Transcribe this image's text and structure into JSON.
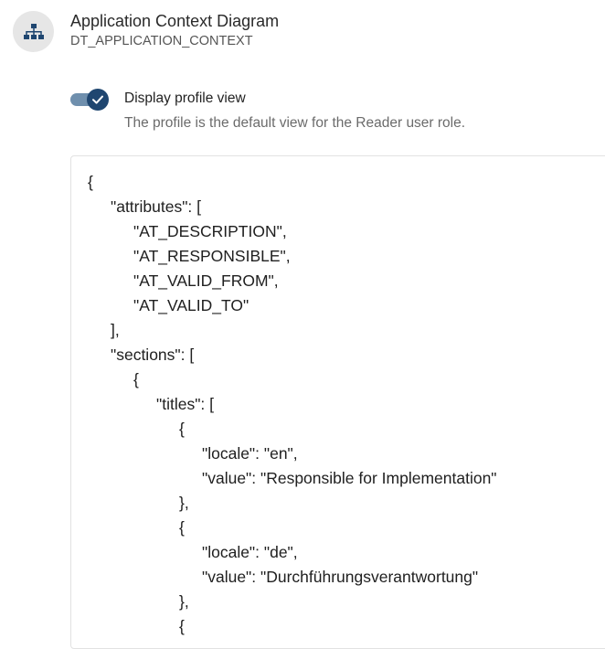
{
  "header": {
    "title": "Application Context Diagram",
    "key": "DT_APPLICATION_CONTEXT",
    "icon": "hierarchy-diagram-icon"
  },
  "profile_toggle": {
    "label": "Display profile view",
    "hint": "The profile is the default view for the Reader user role.",
    "checked": true,
    "colors": {
      "track": "#6f8fad",
      "thumb": "#1f4670"
    }
  },
  "editor": {
    "lines": [
      {
        "indent": 0,
        "text": "{"
      },
      {
        "indent": 1,
        "text": "\"attributes\": ["
      },
      {
        "indent": 2,
        "text": "\"AT_DESCRIPTION\","
      },
      {
        "indent": 2,
        "text": "\"AT_RESPONSIBLE\","
      },
      {
        "indent": 2,
        "text": "\"AT_VALID_FROM\","
      },
      {
        "indent": 2,
        "text": "\"AT_VALID_TO\""
      },
      {
        "indent": 1,
        "text": "],"
      },
      {
        "indent": 1,
        "text": "\"sections\": ["
      },
      {
        "indent": 2,
        "text": "{"
      },
      {
        "indent": 3,
        "text": "\"titles\": ["
      },
      {
        "indent": 4,
        "text": "{"
      },
      {
        "indent": 5,
        "text": "\"locale\": \"en\","
      },
      {
        "indent": 5,
        "text": "\"value\": \"Responsible for Implementation\""
      },
      {
        "indent": 4,
        "text": "},"
      },
      {
        "indent": 4,
        "text": "{"
      },
      {
        "indent": 5,
        "text": "\"locale\": \"de\","
      },
      {
        "indent": 5,
        "text": "\"value\": \"Durchführungsverantwortung\""
      },
      {
        "indent": 4,
        "text": "},"
      },
      {
        "indent": 4,
        "text": "{"
      }
    ]
  }
}
